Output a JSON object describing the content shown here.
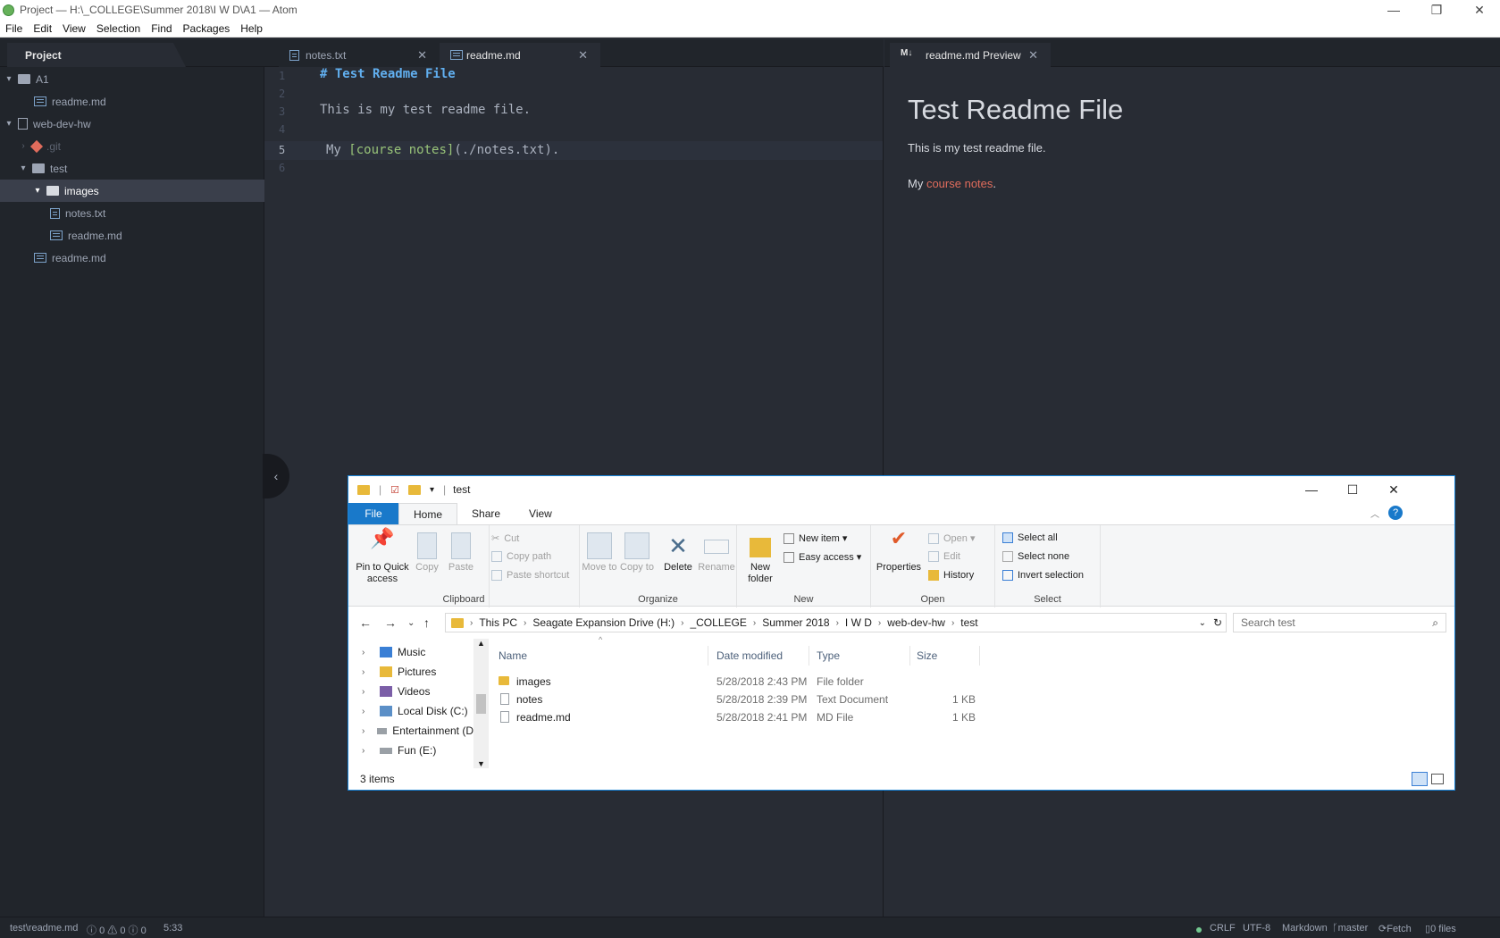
{
  "window": {
    "title": "Project — H:\\_COLLEGE\\Summer 2018\\I W D\\A1 — Atom",
    "controls": {
      "minimize": "—",
      "restore": "❐",
      "close": "✕"
    }
  },
  "menu": [
    "File",
    "Edit",
    "View",
    "Selection",
    "Find",
    "Packages",
    "Help"
  ],
  "tree": {
    "tab_label": "Project",
    "rows": [
      {
        "label": "A1",
        "chevron": "▾"
      },
      {
        "label": "readme.md"
      },
      {
        "label": "web-dev-hw",
        "chevron": "▾"
      },
      {
        "label": ".git",
        "chevron": "›"
      },
      {
        "label": "test",
        "chevron": "▾"
      },
      {
        "label": "images",
        "chevron": "▾"
      },
      {
        "label": "notes.txt"
      },
      {
        "label": "readme.md"
      },
      {
        "label": "readme.md"
      }
    ]
  },
  "editor": {
    "tabs": [
      {
        "label": "notes.txt",
        "close": "✕"
      },
      {
        "label": "readme.md",
        "close": "✕"
      }
    ],
    "line_numbers": [
      "1",
      "2",
      "3",
      "4",
      "5",
      "6"
    ],
    "lines": {
      "l1": "# Test Readme File",
      "l3": "This is my test readme file.",
      "l5_prefix": "My ",
      "l5_link": "[course notes]",
      "l5_url": "(./notes.txt)",
      "l5_suffix": "."
    }
  },
  "preview": {
    "tab_label": "readme.md Preview",
    "tab_close": "✕",
    "tab_icon_text": "M↓",
    "heading": "Test Readme File",
    "para1": "This is my test readme file.",
    "para2_prefix": "My ",
    "para2_link": "course notes",
    "para2_suffix": "."
  },
  "collapse_glyph": "‹",
  "status": {
    "path": "test\\readme.md",
    "errors": "0",
    "warnings": "0",
    "infos": "0",
    "cursor": "5:33",
    "line_ending": "CRLF",
    "encoding": "UTF-8",
    "grammar": "Markdown",
    "branch": "master",
    "fetch": "Fetch",
    "files": "0 files"
  },
  "explorer": {
    "title": "test",
    "controls": {
      "minimize": "—",
      "maximize": "☐",
      "close": "✕"
    },
    "ribbon_tabs": [
      "File",
      "Home",
      "Share",
      "View"
    ],
    "clipboard": {
      "pin": "Pin to Quick access",
      "copy": "Copy",
      "paste": "Paste",
      "cut": "Cut",
      "copy_path": "Copy path",
      "paste_shortcut": "Paste shortcut",
      "label": "Clipboard"
    },
    "organize": {
      "move_to": "Move to",
      "copy_to": "Copy to",
      "delete": "Delete",
      "rename": "Rename",
      "label": "Organize"
    },
    "new": {
      "new_folder": "New folder",
      "new_item": "New item ▾",
      "easy_access": "Easy access ▾",
      "label": "New"
    },
    "open": {
      "properties": "Properties",
      "open": "Open ▾",
      "edit": "Edit",
      "history": "History",
      "label": "Open"
    },
    "select": {
      "select_all": "Select all",
      "select_none": "Select none",
      "invert": "Invert selection",
      "label": "Select"
    },
    "address": [
      "This PC",
      "Seagate Expansion Drive (H:)",
      "_COLLEGE",
      "Summer 2018",
      "I W D",
      "web-dev-hw",
      "test"
    ],
    "search_placeholder": "Search test",
    "nav": [
      {
        "label": "Music",
        "color": "#3a7fd5"
      },
      {
        "label": "Pictures",
        "color": "#e8b93a"
      },
      {
        "label": "Videos",
        "color": "#7b5ea7"
      },
      {
        "label": "Local Disk (C:)",
        "color": "#5b8fc7"
      },
      {
        "label": "Entertainment (D",
        "color": "#9aa0a6"
      },
      {
        "label": "Fun (E:)",
        "color": "#9aa0a6"
      }
    ],
    "columns": [
      "Name",
      "Date modified",
      "Type",
      "Size"
    ],
    "files": [
      {
        "name": "images",
        "date": "5/28/2018 2:43 PM",
        "type": "File folder",
        "size": ""
      },
      {
        "name": "notes",
        "date": "5/28/2018 2:39 PM",
        "type": "Text Document",
        "size": "1 KB"
      },
      {
        "name": "readme.md",
        "date": "5/28/2018 2:41 PM",
        "type": "MD File",
        "size": "1 KB"
      }
    ],
    "item_count": "3 items"
  }
}
